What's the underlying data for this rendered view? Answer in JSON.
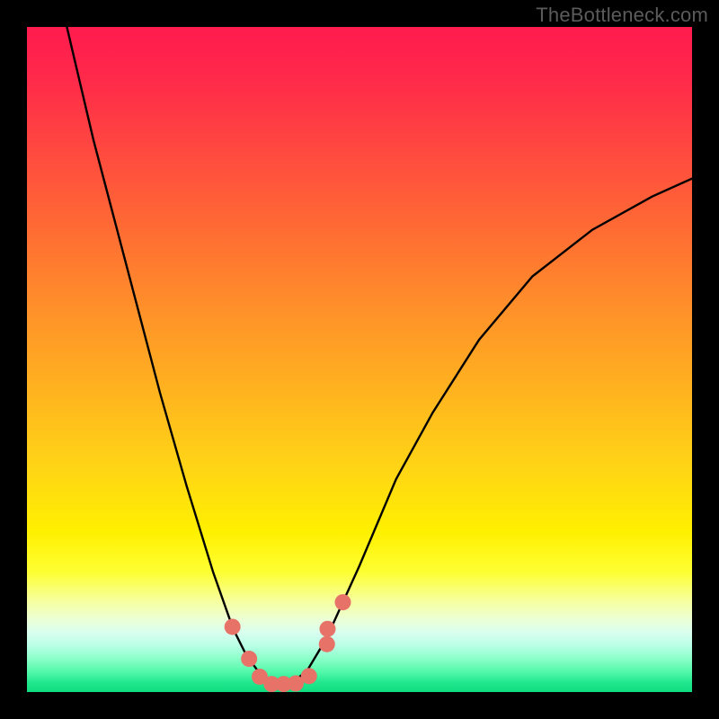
{
  "watermark": "TheBottleneck.com",
  "chart_data": {
    "type": "line",
    "title": "",
    "xlabel": "",
    "ylabel": "",
    "xlim": [
      0,
      1
    ],
    "ylim": [
      0,
      1
    ],
    "grid": false,
    "series": [
      {
        "name": "curve",
        "color": "#000000",
        "x": [
          0.06,
          0.1,
          0.15,
          0.2,
          0.24,
          0.28,
          0.31,
          0.33,
          0.35,
          0.372,
          0.395,
          0.42,
          0.45,
          0.5,
          0.555,
          0.61,
          0.68,
          0.76,
          0.85,
          0.94,
          1.0
        ],
        "y": [
          1.0,
          0.83,
          0.64,
          0.45,
          0.31,
          0.18,
          0.095,
          0.055,
          0.028,
          0.013,
          0.013,
          0.03,
          0.08,
          0.19,
          0.32,
          0.42,
          0.53,
          0.625,
          0.695,
          0.745,
          0.772
        ]
      },
      {
        "name": "markers",
        "color": "#e77267",
        "x": [
          0.309,
          0.334,
          0.35,
          0.368,
          0.386,
          0.404,
          0.424,
          0.451,
          0.452,
          0.475
        ],
        "y": [
          0.098,
          0.05,
          0.023,
          0.012,
          0.012,
          0.013,
          0.024,
          0.072,
          0.095,
          0.135
        ]
      }
    ],
    "background_gradient_stops": [
      {
        "pos": 0.0,
        "color": "#ff1b4e"
      },
      {
        "pos": 0.5,
        "color": "#ffb41f"
      },
      {
        "pos": 0.8,
        "color": "#fdff33"
      },
      {
        "pos": 0.9,
        "color": "#ecffd4"
      },
      {
        "pos": 1.0,
        "color": "#0fdc80"
      }
    ]
  }
}
